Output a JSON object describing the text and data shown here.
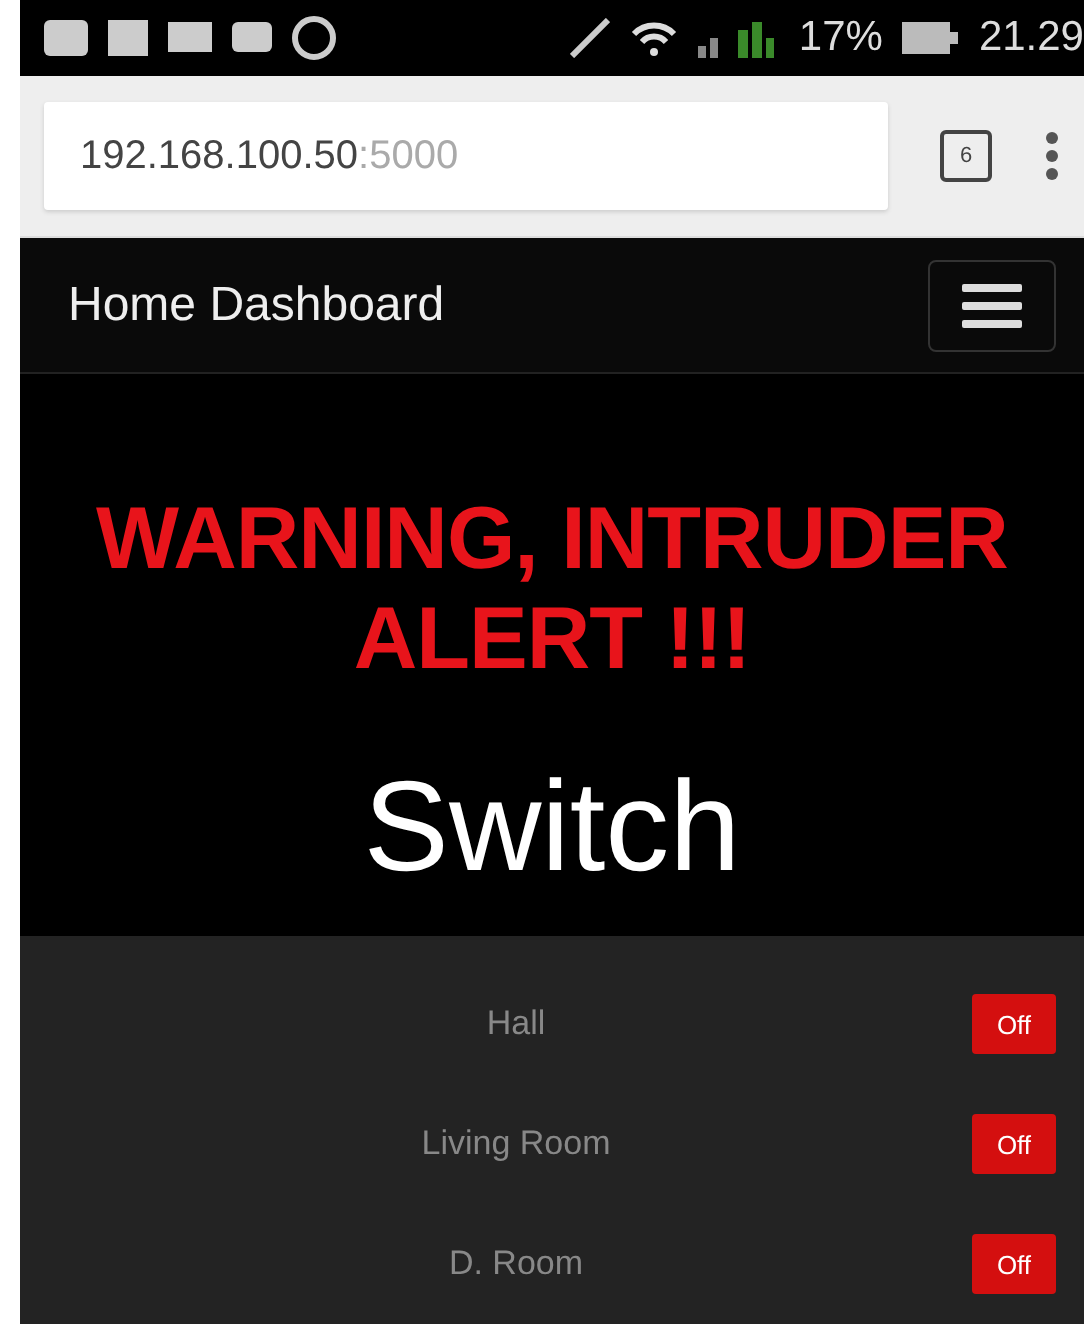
{
  "status_bar": {
    "battery": "17%",
    "time": "21.29"
  },
  "browser": {
    "url_host": "192.168.100.50",
    "url_port": ":5000",
    "tab_count": "6"
  },
  "navbar": {
    "title": "Home Dashboard"
  },
  "alert": "WARNING, INTRUDER ALERT !!!",
  "section_title": "Switch",
  "switches": [
    {
      "name": "Hall",
      "label": "Off",
      "on": false
    },
    {
      "name": "Living Room",
      "label": "Off",
      "on": false
    },
    {
      "name": "D. Room",
      "label": "Off",
      "on": false
    }
  ]
}
